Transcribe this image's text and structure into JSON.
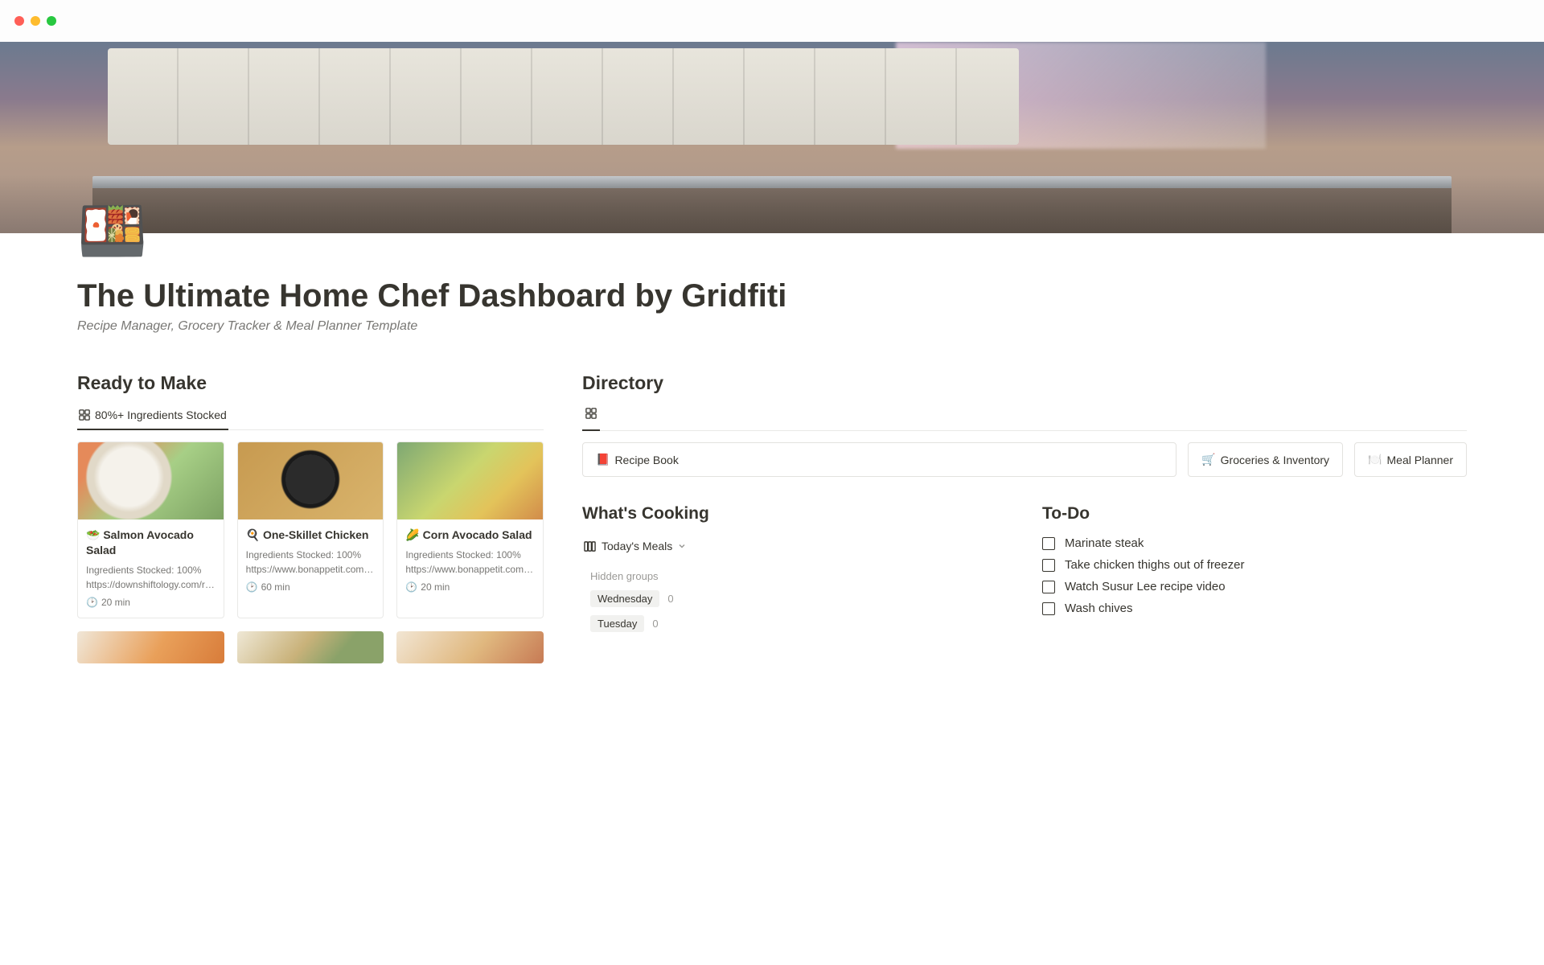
{
  "page": {
    "icon": "🍱",
    "title": "The Ultimate Home Chef Dashboard by Gridfiti",
    "subtitle": "Recipe Manager, Grocery Tracker & Meal Planner Template"
  },
  "ready": {
    "heading": "Ready to Make",
    "tab_label": "80%+ Ingredients Stocked",
    "cards": [
      {
        "emoji": "🥗",
        "title": "Salmon Avocado Salad",
        "stocked": "Ingredients Stocked: 100%",
        "url": "https://downshiftology.com/reci",
        "time": "20 min"
      },
      {
        "emoji": "🍳",
        "title": "One-Skillet Chicken",
        "stocked": "Ingredients Stocked: 100%",
        "url": "https://www.bonappetit.com/rec",
        "time": "60 min"
      },
      {
        "emoji": "🌽",
        "title": "Corn Avocado Salad",
        "stocked": "Ingredients Stocked: 100%",
        "url": "https://www.bonappetit.com/co",
        "time": "20 min"
      }
    ]
  },
  "directory": {
    "heading": "Directory",
    "buttons": [
      {
        "emoji": "📕",
        "label": "Recipe Book"
      },
      {
        "emoji": "🛒",
        "label": "Groceries & Inventory"
      },
      {
        "emoji": "🍽️",
        "label": "Meal Planner"
      }
    ]
  },
  "cooking": {
    "heading": "What's Cooking",
    "view_label": "Today's Meals",
    "hidden_label": "Hidden groups",
    "groups": [
      {
        "name": "Wednesday",
        "count": "0"
      },
      {
        "name": "Tuesday",
        "count": "0"
      }
    ]
  },
  "todo": {
    "heading": "To-Do",
    "items": [
      "Marinate steak",
      "Take chicken thighs out of freezer",
      "Watch Susur Lee recipe video",
      "Wash chives"
    ]
  }
}
